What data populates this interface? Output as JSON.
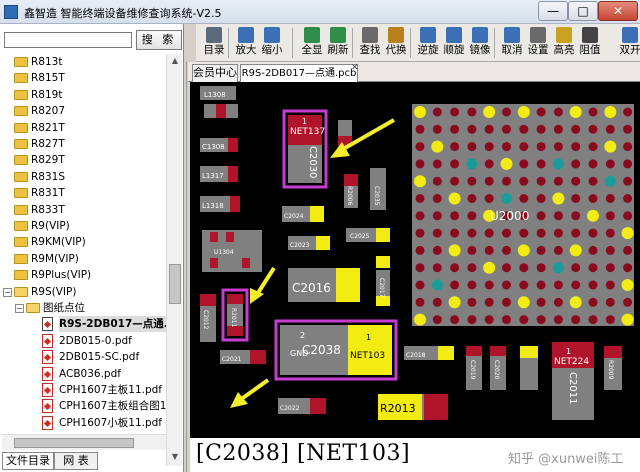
{
  "window": {
    "title": "鑫智造 智能终端设备维修查询系统-V2.5",
    "minimize": "—",
    "maximize": "□",
    "close": "✕"
  },
  "search": {
    "value": "",
    "button": "搜 索"
  },
  "tree": {
    "items": [
      {
        "label": "R813t",
        "kind": "folder",
        "level": 0
      },
      {
        "label": "R815T",
        "kind": "folder",
        "level": 0
      },
      {
        "label": "R819t",
        "kind": "folder",
        "level": 0
      },
      {
        "label": "R8207",
        "kind": "folder",
        "level": 0
      },
      {
        "label": "R821T",
        "kind": "folder",
        "level": 0
      },
      {
        "label": "R827T",
        "kind": "folder",
        "level": 0
      },
      {
        "label": "R829T",
        "kind": "folder",
        "level": 0
      },
      {
        "label": "R831S",
        "kind": "folder",
        "level": 0
      },
      {
        "label": "R831T",
        "kind": "folder",
        "level": 0
      },
      {
        "label": "R833T",
        "kind": "folder",
        "level": 0
      },
      {
        "label": "R9(VIP)",
        "kind": "folder",
        "level": 0
      },
      {
        "label": "R9KM(VIP)",
        "kind": "folder",
        "level": 0
      },
      {
        "label": "R9M(VIP)",
        "kind": "folder",
        "level": 0
      },
      {
        "label": "R9Plus(VIP)",
        "kind": "folder",
        "level": 0
      },
      {
        "label": "R9S(VIP)",
        "kind": "folder-open",
        "level": 0
      },
      {
        "label": "图纸点位",
        "kind": "folder-open",
        "level": 1
      },
      {
        "label": "R9S-2DB017—点通.p",
        "kind": "file",
        "level": 2,
        "selected": true
      },
      {
        "label": "2DB015-0.pdf",
        "kind": "pdf",
        "level": 2
      },
      {
        "label": "2DB015-SC.pdf",
        "kind": "pdf",
        "level": 2
      },
      {
        "label": "ACB036.pdf",
        "kind": "pdf",
        "level": 2
      },
      {
        "label": "CPH1607主板11.pdf",
        "kind": "pdf",
        "level": 2
      },
      {
        "label": "CPH1607主板组合图1",
        "kind": "pdf",
        "level": 2
      },
      {
        "label": "CPH1607小板11.pdf",
        "kind": "pdf",
        "level": 2
      }
    ]
  },
  "bottom_tabs": [
    "文件目录",
    "网 表"
  ],
  "toolbar": {
    "buttons": [
      {
        "label": "目录",
        "icon": "directory-icon",
        "color": "#5a6b7d"
      },
      {
        "label": "放大",
        "icon": "zoom-in-icon",
        "color": "#3b6fb6"
      },
      {
        "label": "缩小",
        "icon": "zoom-out-icon",
        "color": "#3b6fb6"
      },
      {
        "label": "全显",
        "icon": "fit-all-icon",
        "color": "#2f8f4a"
      },
      {
        "label": "刷新",
        "icon": "refresh-icon",
        "color": "#2f8f4a"
      },
      {
        "label": "查找",
        "icon": "find-icon",
        "color": "#6a6a6a"
      },
      {
        "label": "代换",
        "icon": "replace-icon",
        "color": "#b8801c"
      },
      {
        "label": "逆旋",
        "icon": "rotate-ccw-icon",
        "color": "#3b6fb6"
      },
      {
        "label": "顺旋",
        "icon": "rotate-cw-icon",
        "color": "#3b6fb6"
      },
      {
        "label": "镜像",
        "icon": "mirror-icon",
        "color": "#3b6fb6"
      },
      {
        "label": "取消",
        "icon": "cancel-icon",
        "color": "#3b6fb6"
      },
      {
        "label": "设置",
        "icon": "settings-icon",
        "color": "#6a6a6a"
      },
      {
        "label": "高亮",
        "icon": "highlight-icon",
        "color": "#c9a21f"
      },
      {
        "label": "阻值",
        "icon": "resistance-icon",
        "color": "#444444"
      },
      {
        "label": "双开",
        "icon": "dual-open-icon",
        "color": "#3b6fb6"
      }
    ]
  },
  "editor_tabs": [
    "会员中心",
    "R9S-2DB017—点通.pcb"
  ],
  "pcb": {
    "colors": {
      "board": "#000000",
      "part": "#808080",
      "pad_red": "#b0142a",
      "pad_yellow": "#f2ec13",
      "highlight": "#c63bd0",
      "arrow": "#f5ee2a",
      "bga_red": "#8a0a1e",
      "bga_yellow": "#f2ec13",
      "bga_teal": "#1a9c9a"
    },
    "labels": {
      "net137": "NET137",
      "c2030": "C2030",
      "net137_pin": "1",
      "c2038": "C2038",
      "net103": "NET103",
      "net103_pin": "1",
      "gnd": "GND",
      "gnd_pin": "2",
      "c2016": "C2016",
      "u2000": "U2000",
      "net224": "NET224",
      "net224_pin": "1",
      "r2013": "R2013",
      "c2011": "C2011",
      "r2011": "R2011",
      "c2012": "C2012",
      "l1308": "L1308",
      "c1308": "C1308",
      "l1317": "L1317",
      "l1318": "L1318",
      "c2024": "C2024",
      "c2023": "C2023",
      "c2025": "C2025",
      "r2006": "R2006",
      "c2035": "C2035",
      "u1304": "U1304",
      "c2021": "C2021",
      "c2022": "C2022",
      "c2018": "C2018",
      "c2019": "C2019",
      "c2017": "C2017",
      "r2009": "R2009",
      "c2020": "C2020"
    }
  },
  "status": {
    "selection": "[C2038]  [NET103]",
    "watermark": "知乎 @xunwei陈工"
  }
}
